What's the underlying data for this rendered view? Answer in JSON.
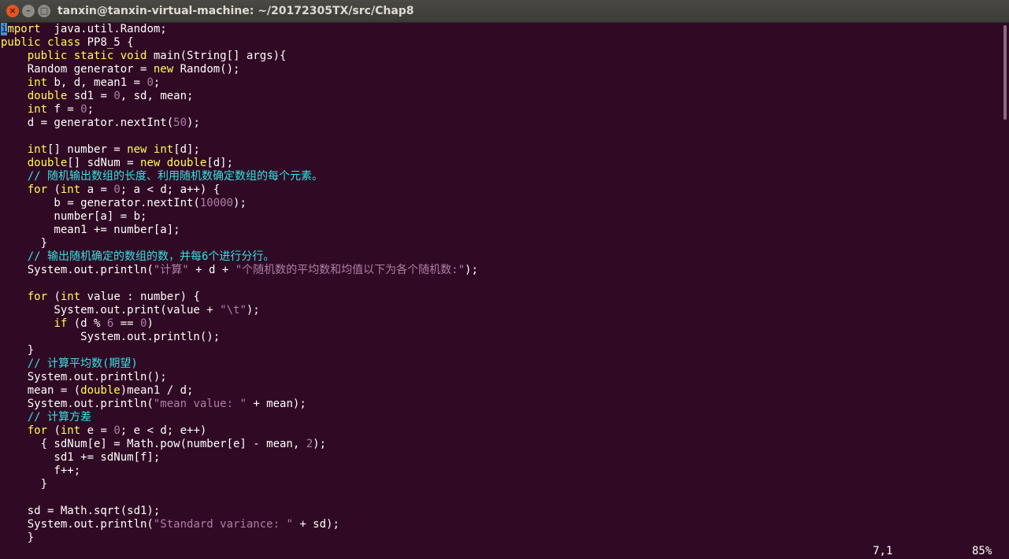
{
  "window": {
    "title": "tanxin@tanxin-virtual-machine: ~/20172305TX/src/Chap8",
    "buttons": {
      "close": "×",
      "minimize": "–",
      "maximize": "□"
    }
  },
  "editor": {
    "lines": [
      [
        [
          "cursor",
          "i"
        ],
        [
          "kw",
          "mport"
        ],
        [
          "",
          "  java.util.Random;"
        ]
      ],
      [
        [
          "kw",
          "public class"
        ],
        [
          "",
          " PP8_5 {"
        ]
      ],
      [
        [
          "",
          "    "
        ],
        [
          "kw",
          "public static void"
        ],
        [
          "",
          " main(String[] args){"
        ]
      ],
      [
        [
          "",
          "    Random generator = "
        ],
        [
          "kw",
          "new"
        ],
        [
          "",
          " Random();"
        ]
      ],
      [
        [
          "",
          "    "
        ],
        [
          "kw",
          "int"
        ],
        [
          "",
          " b, d, mean1 = "
        ],
        [
          "num",
          "0"
        ],
        [
          "",
          ";"
        ]
      ],
      [
        [
          "",
          "    "
        ],
        [
          "kw",
          "double"
        ],
        [
          "",
          " sd1 = "
        ],
        [
          "num",
          "0"
        ],
        [
          "",
          ", sd, mean;"
        ]
      ],
      [
        [
          "",
          "    "
        ],
        [
          "kw",
          "int"
        ],
        [
          "",
          " f = "
        ],
        [
          "num",
          "0"
        ],
        [
          "",
          ";"
        ]
      ],
      [
        [
          "",
          "    d = generator.nextInt("
        ],
        [
          "num",
          "50"
        ],
        [
          "",
          ");"
        ]
      ],
      [
        [
          "",
          ""
        ]
      ],
      [
        [
          "",
          "    "
        ],
        [
          "kw",
          "int"
        ],
        [
          "",
          "[] number = "
        ],
        [
          "kw",
          "new int"
        ],
        [
          "",
          "[d];"
        ]
      ],
      [
        [
          "",
          "    "
        ],
        [
          "kw",
          "double"
        ],
        [
          "",
          "[] sdNum = "
        ],
        [
          "kw",
          "new double"
        ],
        [
          "",
          "[d];"
        ]
      ],
      [
        [
          "",
          "    "
        ],
        [
          "cm",
          "// 随机输出数组的长度、利用随机数确定数组的每个元素。"
        ]
      ],
      [
        [
          "",
          "    "
        ],
        [
          "kw",
          "for"
        ],
        [
          "",
          " ("
        ],
        [
          "kw",
          "int"
        ],
        [
          "",
          " a = "
        ],
        [
          "num",
          "0"
        ],
        [
          "",
          "; a < d; a++) {"
        ]
      ],
      [
        [
          "",
          "        b = generator.nextInt("
        ],
        [
          "num",
          "10000"
        ],
        [
          "",
          ");"
        ]
      ],
      [
        [
          "",
          "        number[a] = b;"
        ]
      ],
      [
        [
          "",
          "        mean1 += number[a];"
        ]
      ],
      [
        [
          "",
          "      }"
        ]
      ],
      [
        [
          "",
          "    "
        ],
        [
          "cm",
          "// 输出随机确定的数组的数，并每6个进行分行。"
        ]
      ],
      [
        [
          "",
          "    System.out.println("
        ],
        [
          "str",
          "\"计算\""
        ],
        [
          "",
          " + d + "
        ],
        [
          "str",
          "\"个随机数的平均数和均值以下为各个随机数:\""
        ],
        [
          "",
          ");"
        ]
      ],
      [
        [
          "",
          ""
        ]
      ],
      [
        [
          "",
          "    "
        ],
        [
          "kw",
          "for"
        ],
        [
          "",
          " ("
        ],
        [
          "kw",
          "int"
        ],
        [
          "",
          " value : number) {"
        ]
      ],
      [
        [
          "",
          "        System.out.print(value + "
        ],
        [
          "str",
          "\"\\t\""
        ],
        [
          "",
          ");"
        ]
      ],
      [
        [
          "",
          "        "
        ],
        [
          "kw",
          "if"
        ],
        [
          "",
          " (d % "
        ],
        [
          "num",
          "6"
        ],
        [
          "",
          " == "
        ],
        [
          "num",
          "0"
        ],
        [
          "",
          ")"
        ]
      ],
      [
        [
          "",
          "            System.out.println();"
        ]
      ],
      [
        [
          "",
          "    }"
        ]
      ],
      [
        [
          "",
          "    "
        ],
        [
          "cm",
          "// 计算平均数(期望)"
        ]
      ],
      [
        [
          "",
          "    System.out.println();"
        ]
      ],
      [
        [
          "",
          "    mean = ("
        ],
        [
          "kw",
          "double"
        ],
        [
          "",
          ")mean1 / d;"
        ]
      ],
      [
        [
          "",
          "    System.out.println("
        ],
        [
          "str",
          "\"mean value: \""
        ],
        [
          "",
          " + mean);"
        ]
      ],
      [
        [
          "",
          "    "
        ],
        [
          "cm",
          "// 计算方差"
        ]
      ],
      [
        [
          "",
          "    "
        ],
        [
          "kw",
          "for"
        ],
        [
          "",
          " ("
        ],
        [
          "kw",
          "int"
        ],
        [
          "",
          " e = "
        ],
        [
          "num",
          "0"
        ],
        [
          "",
          "; e < d; e++)"
        ]
      ],
      [
        [
          "",
          "      { sdNum[e] = Math.pow(number[e] - mean, "
        ],
        [
          "num",
          "2"
        ],
        [
          "",
          ");"
        ]
      ],
      [
        [
          "",
          "        sd1 += sdNum[f];"
        ]
      ],
      [
        [
          "",
          "        f++;"
        ]
      ],
      [
        [
          "",
          "      }"
        ]
      ],
      [
        [
          "",
          ""
        ]
      ],
      [
        [
          "",
          "    sd = Math.sqrt(sd1);"
        ]
      ],
      [
        [
          "",
          "    System.out.println("
        ],
        [
          "str",
          "\"Standard variance: \""
        ],
        [
          "",
          " + sd);"
        ]
      ],
      [
        [
          "",
          "    }"
        ]
      ]
    ]
  },
  "status": {
    "position": "7,1",
    "percent": "85%"
  },
  "colors": {
    "background": "#300a24",
    "keyword": "#ffff55",
    "number_string": "#ad7fa8",
    "comment": "#34e2e2",
    "cursor": "#3e94d3"
  }
}
